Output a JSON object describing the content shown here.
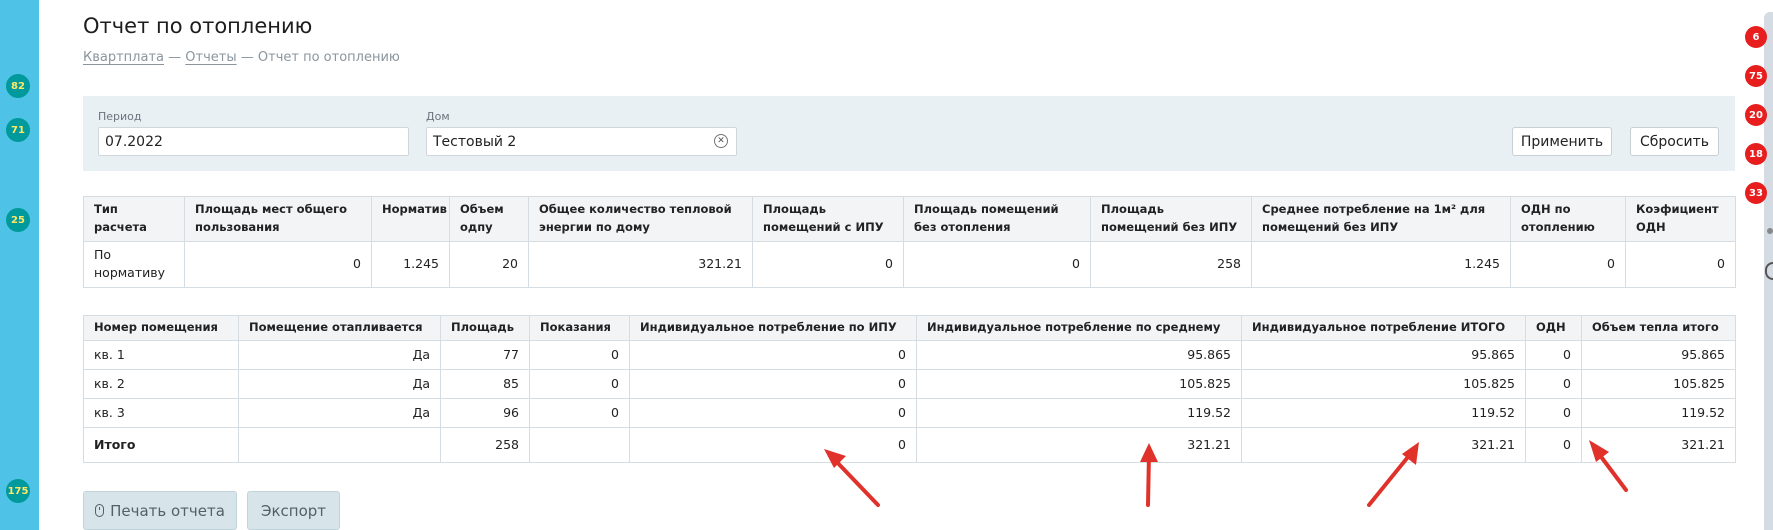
{
  "page": {
    "title": "Отчет по отоплению",
    "breadcrumb": {
      "items": [
        "Квартплата",
        "Отчеты"
      ],
      "current": "Отчет по отоплению",
      "separator": "—"
    }
  },
  "sidebar": {
    "badges": [
      "82",
      "71",
      "25",
      "175"
    ],
    "badge_color": "#009a9c",
    "strip_color": "#4ec3e7"
  },
  "notifications": {
    "badges": [
      "6",
      "75",
      "20",
      "18",
      "33"
    ],
    "badge_color": "#e81d1d"
  },
  "filters": {
    "period_label": "Период",
    "period_value": "07.2022",
    "house_label": "Дом",
    "house_value": "Тестовый 2",
    "apply_label": "Применить",
    "reset_label": "Сбросить"
  },
  "summary_table": {
    "headers": [
      "Тип расчета",
      "Площадь мест общего пользования",
      "Норматив",
      "Объем одпу",
      "Общее количество тепловой энергии по дому",
      "Площадь помещений с ИПУ",
      "Площадь помещений без отопления",
      "Площадь помещений без ИПУ",
      "Среднее потребление на 1м² для помещений без ИПУ",
      "ОДН по отоплению",
      "Коэфициент ОДН"
    ],
    "row": [
      "По нормативу",
      "0",
      "1.245",
      "20",
      "321.21",
      "0",
      "0",
      "258",
      "1.245",
      "0",
      "0"
    ]
  },
  "rooms_table": {
    "headers": [
      "Номер помещения",
      "Помещение отапливается",
      "Площадь",
      "Показания",
      "Индивидуальное потребление по ИПУ",
      "Индивидуальное потребление по среднему",
      "Индивидуальное потребление ИТОГО",
      "ОДН",
      "Объем тепла итого"
    ],
    "rows": [
      [
        "кв. 1",
        "Да",
        "77",
        "0",
        "0",
        "95.865",
        "95.865",
        "0",
        "95.865"
      ],
      [
        "кв. 2",
        "Да",
        "85",
        "0",
        "0",
        "105.825",
        "105.825",
        "0",
        "105.825"
      ],
      [
        "кв. 3",
        "Да",
        "96",
        "0",
        "0",
        "119.52",
        "119.52",
        "0",
        "119.52"
      ]
    ],
    "total": [
      "Итого",
      "",
      "258",
      "",
      "0",
      "321.21",
      "321.21",
      "0",
      "321.21"
    ]
  },
  "actions": {
    "print_label": "Печать отчета",
    "export_label": "Экспорт"
  },
  "annotation_color": "#e0312b"
}
